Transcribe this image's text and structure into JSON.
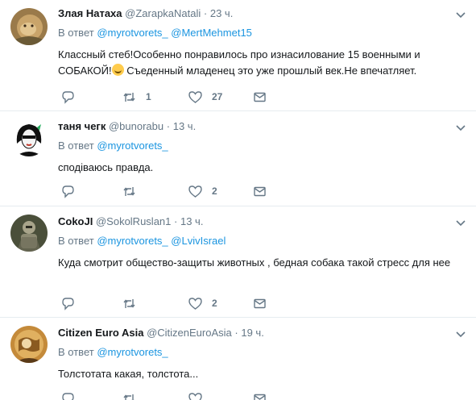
{
  "colors": {
    "link": "#1b95e0",
    "muted": "#657786",
    "text": "#14171a",
    "divider": "#e6ecf0"
  },
  "tweets": [
    {
      "name": "Злая Натаха",
      "handle": "@ZarapkaNatali",
      "dot": "·",
      "time": "23 ч.",
      "reply_prefix": "В ответ",
      "mentions": [
        "@myrotvorets_",
        "@MertMehmet15"
      ],
      "text_a": "Классный стеб!Особенно понравилось про изнасилование 15 военными и СОБАКОЙ!",
      "emoji": "face-with-tears-of-joy",
      "text_b": " Съеденный младенец это уже прошлый век.Не впечатляет.",
      "retweets": "1",
      "likes": "27"
    },
    {
      "name": "таня чегк",
      "handle": "@bunorabu",
      "dot": "·",
      "time": "13 ч.",
      "reply_prefix": "В ответ",
      "mentions": [
        "@myrotvorets_"
      ],
      "text": "сподіваюсь правда.",
      "retweets": "",
      "likes": "2"
    },
    {
      "name": "CokoJI",
      "handle": "@SokolRuslan1",
      "dot": "·",
      "time": "13 ч.",
      "reply_prefix": "В ответ",
      "mentions": [
        "@myrotvorets_",
        "@LvivIsrael"
      ],
      "text": "Куда смотрит общество-защиты животных , бедная собака такой стресс для нее",
      "retweets": "",
      "likes": "2"
    },
    {
      "name": "Citizen Euro Asia",
      "handle": "@CitizenEuroAsia",
      "dot": "·",
      "time": "19 ч.",
      "reply_prefix": "В ответ",
      "mentions": [
        "@myrotvorets_"
      ],
      "text": "Толстотата какая, толстота...",
      "retweets": "",
      "likes": ""
    }
  ]
}
